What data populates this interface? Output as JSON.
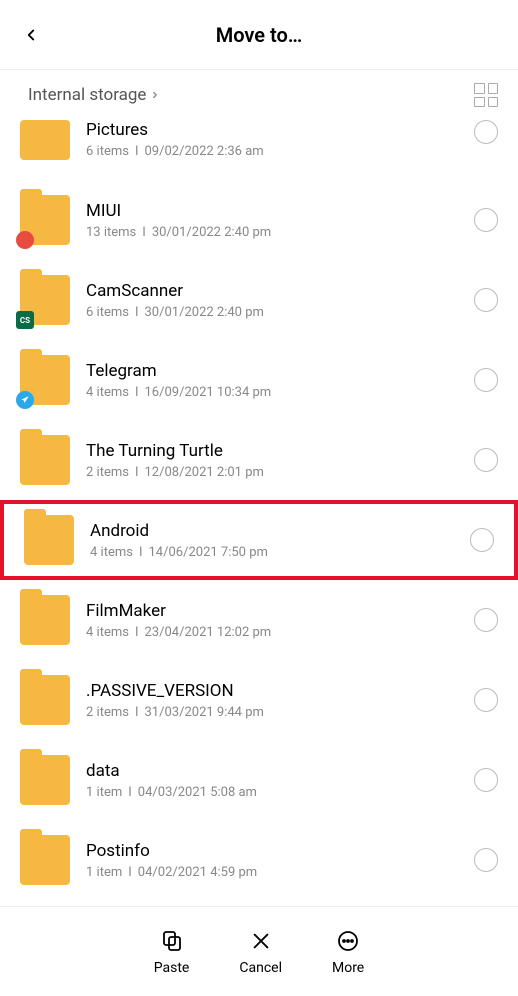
{
  "header": {
    "title": "Move to…"
  },
  "breadcrumb": {
    "label": "Internal storage"
  },
  "folders": [
    {
      "name": "Pictures",
      "count": "6 items",
      "date": "09/02/2022 2:36 am",
      "cutTop": true
    },
    {
      "name": "MIUI",
      "count": "13 items",
      "date": "30/01/2022 2:40 pm",
      "badge": "red"
    },
    {
      "name": "CamScanner",
      "count": "6 items",
      "date": "30/01/2022 2:40 pm",
      "badge": "green",
      "badgeText": "CS"
    },
    {
      "name": "Telegram",
      "count": "4 items",
      "date": "16/09/2021 10:34 pm",
      "badge": "blue"
    },
    {
      "name": "The Turning Turtle",
      "count": "2 items",
      "date": "12/08/2021 2:01 pm"
    },
    {
      "name": "Android",
      "count": "4 items",
      "date": "14/06/2021 7:50 pm",
      "highlight": true
    },
    {
      "name": "FilmMaker",
      "count": "4 items",
      "date": "23/04/2021 12:02 pm"
    },
    {
      "name": ".PASSIVE_VERSION",
      "count": "2 items",
      "date": "31/03/2021 9:44 pm"
    },
    {
      "name": "data",
      "count": "1 item",
      "date": "04/03/2021 5:08 am"
    },
    {
      "name": "Postinfo",
      "count": "1 item",
      "date": "04/02/2021 4:59 pm"
    }
  ],
  "bottomBar": {
    "paste": "Paste",
    "cancel": "Cancel",
    "more": "More"
  }
}
